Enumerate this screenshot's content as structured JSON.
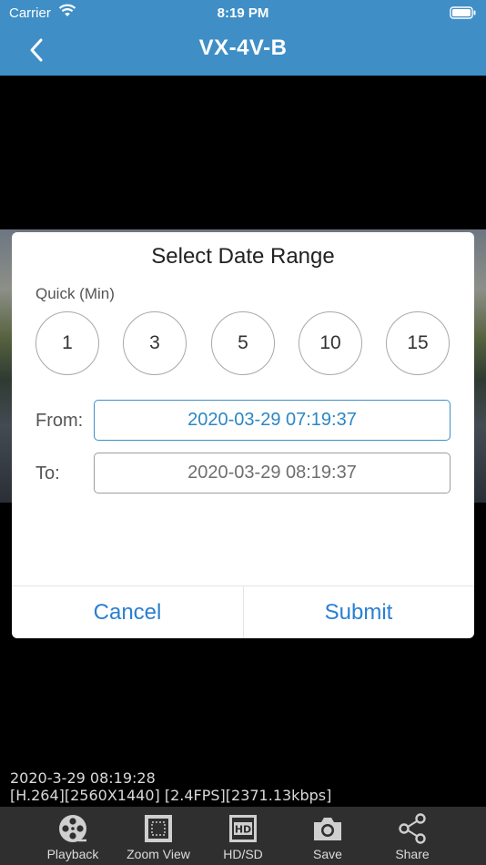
{
  "status_bar": {
    "carrier": "Carrier",
    "time": "8:19 PM"
  },
  "nav": {
    "title": "VX-4V-B",
    "back_icon": "chevron-left-icon"
  },
  "video": {
    "timestamp": "2020-3-29 08:19:28",
    "stream_info": "[H.264][2560X1440]  [2.4FPS][2371.13kbps]"
  },
  "dialog": {
    "title": "Select Date Range",
    "quick_label": "Quick (Min)",
    "quick_options": [
      "1",
      "3",
      "5",
      "10",
      "15"
    ],
    "from_label": "From:",
    "from_value": "2020-03-29 07:19:37",
    "to_label": "To:",
    "to_value": "2020-03-29 08:19:37",
    "cancel_label": "Cancel",
    "submit_label": "Submit",
    "accent_color": "#2a7fd1"
  },
  "toolbar": {
    "items": [
      {
        "label": "Playback",
        "icon": "film-reel-icon"
      },
      {
        "label": "Zoom View",
        "icon": "zoom-view-icon"
      },
      {
        "label": "HD/SD",
        "icon": "hd-icon"
      },
      {
        "label": "Save",
        "icon": "camera-icon"
      },
      {
        "label": "Share",
        "icon": "share-icon"
      }
    ]
  },
  "colors": {
    "nav_background": "#3f8fc6",
    "toolbar_background": "#2f2f2f"
  }
}
